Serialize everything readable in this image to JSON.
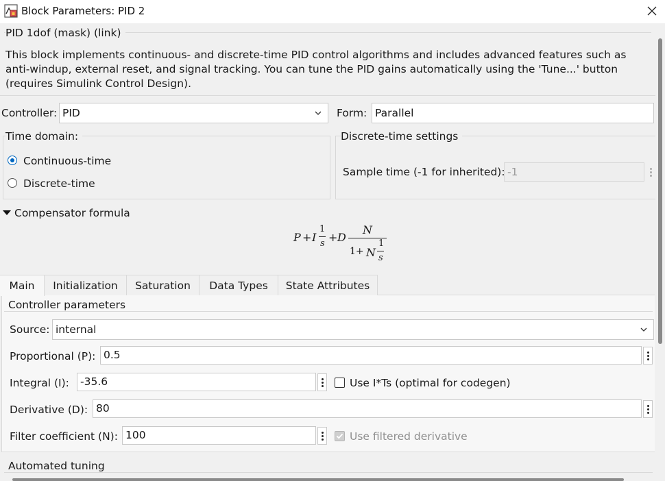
{
  "window": {
    "title": "Block Parameters: PID 2",
    "icon": "simulink-block-icon",
    "close_icon": "close-icon"
  },
  "header": {
    "group_title": "PID 1dof (mask) (link)",
    "description": "This block implements continuous- and discrete-time PID control algorithms and includes advanced features such as anti-windup, external reset, and signal tracking. You can tune the PID gains automatically using the 'Tune...' button (requires Simulink Control Design)."
  },
  "controller": {
    "label": "Controller:",
    "value": "PID"
  },
  "form": {
    "label": "Form:",
    "value": "Parallel"
  },
  "time_domain": {
    "label": "Time domain:",
    "options": [
      {
        "label": "Continuous-time",
        "selected": true
      },
      {
        "label": "Discrete-time",
        "selected": false
      }
    ]
  },
  "discrete_settings": {
    "title": "Discrete-time settings",
    "sample_time_label": "Sample time (-1 for inherited):",
    "sample_time_value": "-1"
  },
  "compensator": {
    "title": "Compensator formula",
    "formula_tokens": {
      "P": "P",
      "plus": "+",
      "I": "I",
      "one": "1",
      "s": "s",
      "D": "D",
      "N": "N",
      "one_plus": "1+"
    }
  },
  "tabs": [
    {
      "label": "Main",
      "active": true
    },
    {
      "label": "Initialization",
      "active": false
    },
    {
      "label": "Saturation",
      "active": false
    },
    {
      "label": "Data Types",
      "active": false
    },
    {
      "label": "State Attributes",
      "active": false
    }
  ],
  "main": {
    "group_title": "Controller parameters",
    "source": {
      "label": "Source:",
      "value": "internal"
    },
    "proportional": {
      "label": "Proportional (P):",
      "value": "0.5"
    },
    "integral": {
      "label": "Integral (I):",
      "value": "-35.6"
    },
    "use_its": {
      "label": "Use I*Ts (optimal for codegen)",
      "checked": false
    },
    "derivative": {
      "label": "Derivative (D):",
      "value": "80"
    },
    "filter": {
      "label": "Filter coefficient (N):",
      "value": "100"
    },
    "use_filtered": {
      "label": "Use filtered derivative",
      "checked": true,
      "disabled": true
    },
    "automated_tuning": "Automated tuning"
  },
  "colors": {
    "accent": "#0067c0",
    "background": "#f0f0f0",
    "field": "#ffffff"
  }
}
